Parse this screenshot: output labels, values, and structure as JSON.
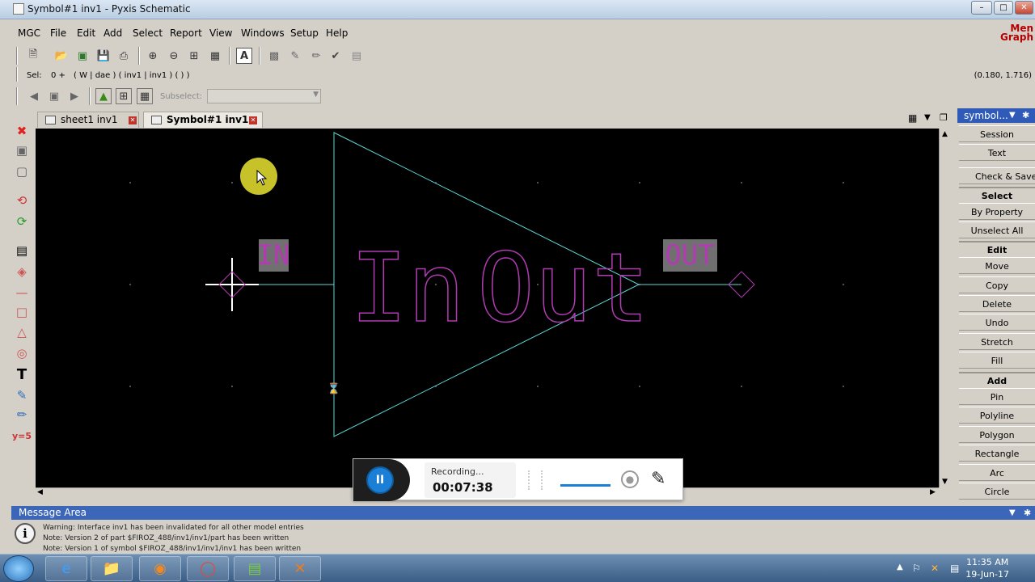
{
  "window": {
    "title": "Symbol#1 inv1 - Pyxis Schematic"
  },
  "menu": [
    "MGC",
    "File",
    "Edit",
    "Add",
    "Select",
    "Report",
    "View",
    "Windows",
    "Setup",
    "Help"
  ],
  "brand": {
    "line1": "Men",
    "line2": "Graph"
  },
  "selection": {
    "label": "Sel:",
    "count": "0 +",
    "path": "( W | dae ) ( inv1 | inv1 ) ( ) )",
    "coords": "(0.180, 1.716)"
  },
  "subselect": {
    "label": "Subselect:"
  },
  "tabs": [
    {
      "label": "sheet1 inv1",
      "active": false
    },
    {
      "label": "Symbol#1 inv1",
      "active": true
    }
  ],
  "canvas": {
    "pin_in": "IN",
    "pin_out": "OUT",
    "text_in": "In",
    "text_out": "Out"
  },
  "panel": {
    "header": "symbol...",
    "items": [
      {
        "label": "Session",
        "kind": "button"
      },
      {
        "label": "Text",
        "kind": "button"
      },
      {
        "label": "Check & Saves",
        "kind": "button"
      },
      {
        "label": "Select",
        "kind": "section"
      },
      {
        "label": "By Property",
        "kind": "button"
      },
      {
        "label": "Unselect All",
        "kind": "button"
      },
      {
        "label": "Edit",
        "kind": "section"
      },
      {
        "label": "Move",
        "kind": "button"
      },
      {
        "label": "Copy",
        "kind": "button"
      },
      {
        "label": "Delete",
        "kind": "button"
      },
      {
        "label": "Undo",
        "kind": "button"
      },
      {
        "label": "Stretch",
        "kind": "button"
      },
      {
        "label": "Fill",
        "kind": "button"
      },
      {
        "label": "Add",
        "kind": "section"
      },
      {
        "label": "Pin",
        "kind": "button"
      },
      {
        "label": "Polyline",
        "kind": "button"
      },
      {
        "label": "Polygon",
        "kind": "button"
      },
      {
        "label": "Rectangle",
        "kind": "button"
      },
      {
        "label": "Arc",
        "kind": "button"
      },
      {
        "label": "Circle",
        "kind": "button"
      }
    ]
  },
  "messages": {
    "title": "Message Area",
    "lines": [
      "Warning: Interface inv1 has been invalidated for all other model entries",
      "Note: Version 2 of part $FIROZ_488/inv1/inv1/part has been written",
      "Note: Version 1 of symbol $FIROZ_488/inv1/inv1/inv1 has been written"
    ]
  },
  "recorder": {
    "status": "Recording...",
    "time": "00:07:38"
  },
  "clock": {
    "time": "11:35 AM",
    "date": "19-Jun-17"
  },
  "colors": {
    "symbol_outline": "#5fd8d8",
    "symbol_text": "#b23bb2",
    "pin_label_bg": "#707070",
    "grid_dot": "#6b6b6b",
    "cursor_highlight": "#c7c22a"
  }
}
